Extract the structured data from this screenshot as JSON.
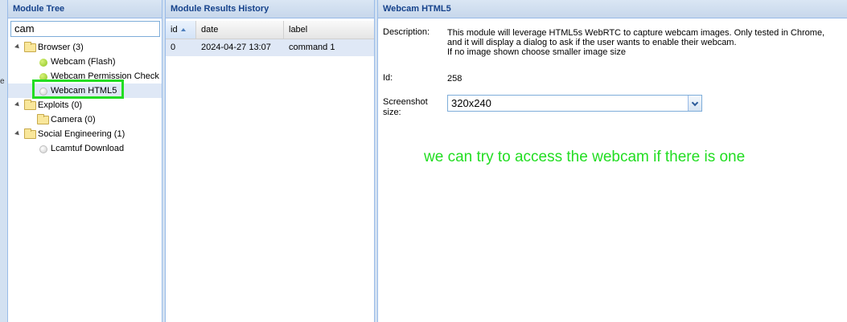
{
  "edge_text": "e",
  "module_tree": {
    "title": "Module Tree",
    "search_value": "cam",
    "nodes": [
      {
        "label": "Browser (3)",
        "type": "folder"
      },
      {
        "label": "Webcam (Flash)",
        "type": "module",
        "status": "green"
      },
      {
        "label": "Webcam Permission Check",
        "type": "module",
        "status": "green"
      },
      {
        "label": "Webcam HTML5",
        "type": "module",
        "status": "white"
      },
      {
        "label": "Exploits (0)",
        "type": "folder"
      },
      {
        "label": "Camera (0)",
        "type": "folder"
      },
      {
        "label": "Social Engineering (1)",
        "type": "folder"
      },
      {
        "label": "Lcamtuf Download",
        "type": "module",
        "status": "white"
      }
    ]
  },
  "results_history": {
    "title": "Module Results History",
    "columns": [
      "id",
      "date",
      "label"
    ],
    "rows": [
      {
        "id": "0",
        "date": "2024-04-27 13:07",
        "label": "command 1"
      }
    ]
  },
  "detail": {
    "title": "Webcam HTML5",
    "description_label": "Description:",
    "description_lines": [
      "This module will leverage HTML5s WebRTC to capture webcam images. Only tested in Chrome,",
      "and it will display a dialog to ask if the user wants to enable their webcam.",
      "If no image shown choose smaller image size"
    ],
    "id_label": "Id:",
    "id_value": "258",
    "screenshot_label_line1": "Screenshot",
    "screenshot_label_line2": "size:",
    "screenshot_value": "320x240"
  },
  "annotation": "we can try to access the webcam if there is one",
  "colors": {
    "header_text": "#15428b",
    "panel_border": "#99bbe8",
    "selection": "#dfe8f6",
    "highlight_green": "#22dd22"
  }
}
